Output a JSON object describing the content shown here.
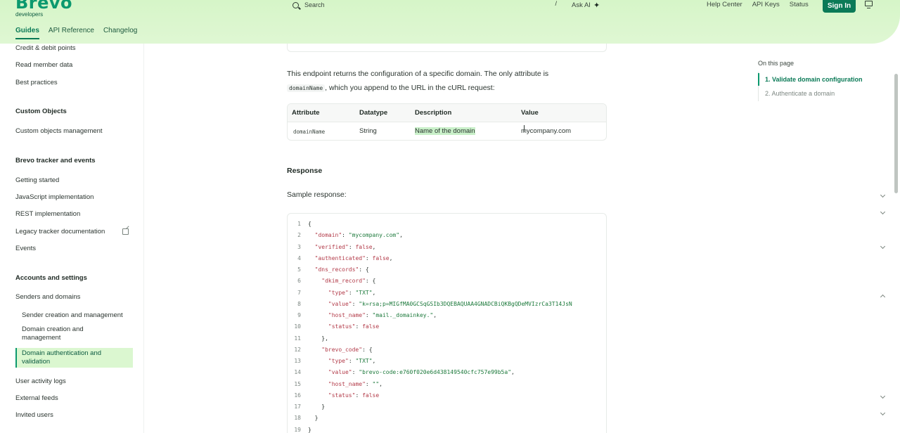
{
  "header": {
    "logo_word": "Brevo",
    "logo_sub": "developers",
    "search_placeholder": "Search",
    "search_shortcut": "/",
    "ask_ai": "Ask AI",
    "links": [
      "Help Center",
      "API Keys",
      "Status"
    ],
    "sign_in": "Sign In",
    "tabs": [
      "Guides",
      "API Reference",
      "Changelog"
    ]
  },
  "sidebar": {
    "credit_debit": "Credit & debit points",
    "read_member": "Read member data",
    "best_practices": "Best practices",
    "custom_objects_head": "Custom Objects",
    "custom_objects_mgmt": "Custom objects management",
    "tracker_head": "Brevo tracker and events",
    "getting_started": "Getting started",
    "js_impl": "JavaScript implementation",
    "rest_impl": "REST implementation",
    "legacy_tracker": "Legacy tracker documentation",
    "events": "Events",
    "accounts_head": "Accounts and settings",
    "senders_domains": "Senders and domains",
    "sender_creation": "Sender creation and management",
    "domain_creation": "Domain creation and management",
    "domain_auth": "Domain authentication and validation",
    "user_activity": "User activity logs",
    "external_feeds": "External feeds",
    "invited_users": "Invited users"
  },
  "content": {
    "intro_1": "This endpoint returns the configuration of a specific domain. The only attribute is",
    "intro_code": "domainName",
    "intro_2": ", which you append to the URL in the cURL request:",
    "table": {
      "headers": [
        "Attribute",
        "Datatype",
        "Description",
        "Value"
      ],
      "row": [
        "domainName",
        "String",
        "Name of the domain",
        "mycompany.com"
      ]
    },
    "response_heading": "Response",
    "sample_label": "Sample response:",
    "code_lines": [
      "{",
      "  \"domain\": \"mycompany.com\",",
      "  \"verified\": false,",
      "  \"authenticated\": false,",
      "  \"dns_records\": {",
      "    \"dkim_record\": {",
      "      \"type\": \"TXT\",",
      "      \"value\": \"k=rsa;p=MIGfMA0GCSqGSIb3DQEBAQUAA4GNADCBiQKBgQDeMVIzrCa3T14JsN",
      "      \"host_name\": \"mail._domainkey.\",",
      "      \"status\": false",
      "    },",
      "    \"brevo_code\": {",
      "      \"type\": \"TXT\",",
      "      \"value\": \"brevo-code:e760f020e6d438149540cfc757e99b5a\",",
      "      \"host_name\": \"\",",
      "      \"status\": false",
      "    }",
      "  }",
      "}"
    ]
  },
  "toc": {
    "title": "On this page",
    "items": [
      "1. Validate domain configuration",
      "2. Authenticate a domain"
    ]
  },
  "colors": {
    "brand": "#0b996e",
    "header_bg": "#d6f5c8",
    "active_bg": "#dbf7d0",
    "button": "#0b7a57"
  }
}
